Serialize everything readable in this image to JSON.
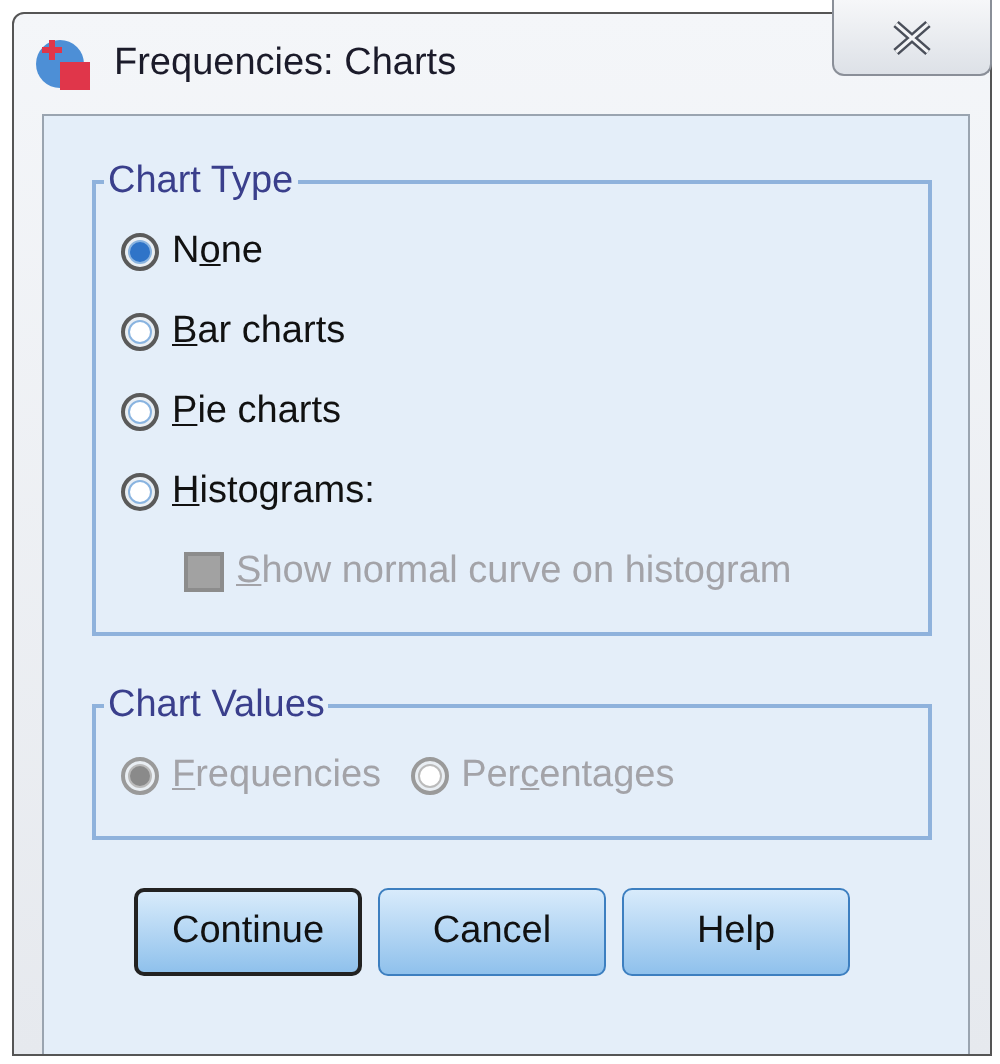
{
  "window": {
    "title": "Frequencies: Charts"
  },
  "chart_type": {
    "legend": "Chart Type",
    "options": [
      {
        "label": {
          "before": "N",
          "key": "o",
          "after": "ne"
        },
        "selected": true
      },
      {
        "label": {
          "key": "B",
          "after": "ar charts"
        },
        "selected": false
      },
      {
        "label": {
          "key": "P",
          "after": "ie charts"
        },
        "selected": false
      },
      {
        "label": {
          "key": "H",
          "after": "istograms:"
        },
        "selected": false
      }
    ],
    "normal_curve": {
      "label": {
        "key": "S",
        "after": "how normal curve on histogram"
      },
      "checked": false,
      "disabled": true
    }
  },
  "chart_values": {
    "legend": "Chart Values",
    "disabled": true,
    "options": [
      {
        "label": {
          "key": "F",
          "after": "requencies"
        },
        "selected": true
      },
      {
        "label": {
          "before": "Per",
          "key": "c",
          "after": "entages"
        },
        "selected": false
      }
    ]
  },
  "buttons": [
    {
      "label": "Continue",
      "default": true
    },
    {
      "label": "Cancel",
      "default": false
    },
    {
      "label": "Help",
      "default": false
    }
  ]
}
